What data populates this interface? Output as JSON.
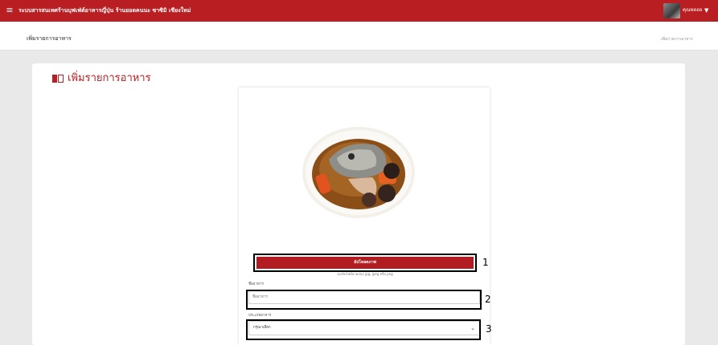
{
  "topbar": {
    "menu_icon": "hamburger-menu-icon",
    "app_title": "ระบบสารสนเทศร้านบุฟเฟ่ต์อาหารญี่ปุ่น ร้านยอดคนนะ ซาซิมิ เชียงใหม่",
    "user_name": "คุณพลอย",
    "caret": "▼",
    "colors": {
      "primary": "#b81e22"
    }
  },
  "subbar": {
    "heading": "เพิ่มรายการอาหาร",
    "breadcrumb": "เพิ่มรายการอาหาร"
  },
  "card": {
    "title": "เพิ่มรายการอาหาร",
    "title_icon": "book-icon"
  },
  "form": {
    "upload_button": "อัปโหลดภาพ",
    "upload_hint": "รองรับไฟล์นามสกุล jpg, jpeg หรือ png",
    "name_label": "ชื่ออาหาร",
    "name_placeholder": "ชื่ออาหาร",
    "type_label": "ประเภทอาหาร",
    "type_selected": "กรุณาเลือก"
  },
  "annotations": {
    "1": "1",
    "2": "2",
    "3": "3"
  }
}
